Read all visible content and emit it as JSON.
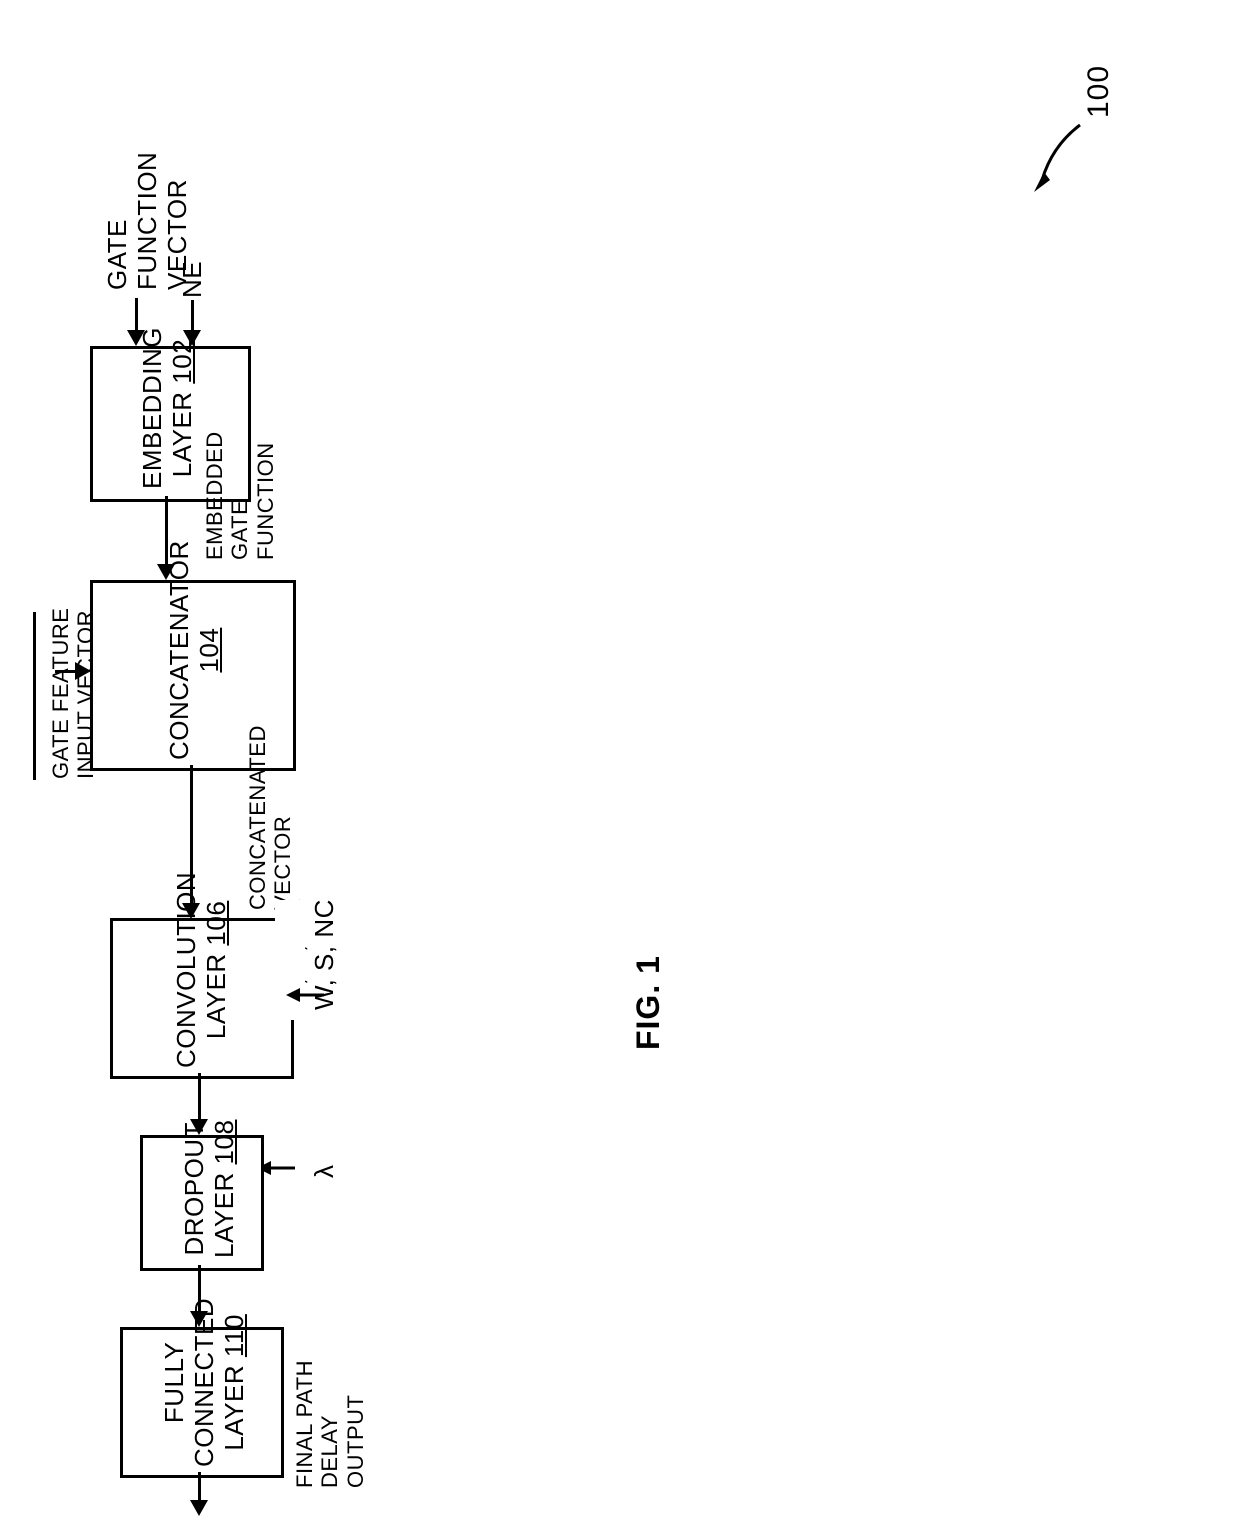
{
  "ref_number": "100",
  "figure_label": "FIG. 1",
  "inputs": {
    "gate_function_vector": "GATE\nFUNCTION\nVECTOR",
    "ne_param": "NE",
    "embedded_gate_function": "EMBEDDED\nGATE\nFUNCTION",
    "gate_feature_input_vector": "GATE FEATURE\nINPUT VECTOR",
    "concatenated_vector": "CONCATENATED\nVECTOR",
    "conv_params": "W, S, NC",
    "dropout_param": "λ",
    "final_output": "FINAL PATH\nDELAY\nOUTPUT"
  },
  "blocks": {
    "embedding": {
      "title": "EMBEDDING",
      "sub": "LAYER ",
      "num": "102"
    },
    "concatenator": {
      "title": "CONCATENATOR",
      "num": "104"
    },
    "convolution": {
      "title": "CONVOLUTION",
      "sub": "LAYER ",
      "num": "106"
    },
    "dropout": {
      "title": "DROPOUT",
      "sub": "LAYER ",
      "num": "108"
    },
    "fully_connected": {
      "line1": "FULLY",
      "line2": "CONNECTED",
      "sub": "LAYER ",
      "num": "110"
    }
  }
}
